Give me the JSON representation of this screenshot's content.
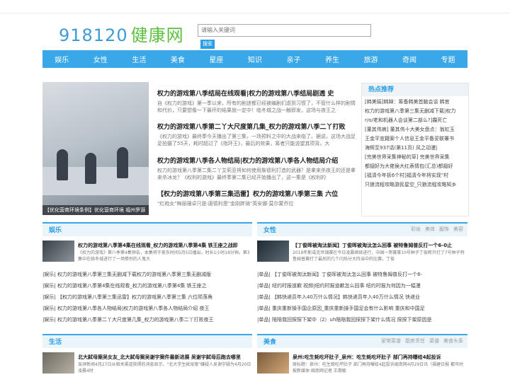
{
  "logo": {
    "number": "918120",
    "cn": "健康网"
  },
  "search": {
    "placeholder": "请输入关键词",
    "button": "搜索"
  },
  "nav": [
    "娱乐",
    "女性",
    "生活",
    "美食",
    "星座",
    "知识",
    "亲子",
    "养生",
    "旅游",
    "奇闻",
    "专题"
  ],
  "slideshow": {
    "caption": "【优化营商环境条例】优化营商环境 福州罗源"
  },
  "news": [
    {
      "title": "权力的游戏第八季结局在线观看|权力的游戏第八季结局剧透 史",
      "desc": "自《权力的游戏》第一季以来，所有的剧迷都已经被编剧们虐到习惯了，不管什么样的剧情和代价，只要想像一下最坏的结果就一定中！临冬城之战一触即发，这场与夜王之"
    },
    {
      "title": "权力的游戏第八季第二丫大尺度第几集_权力的游戏第八季二丫打败",
      "desc": "《权力的游戏》最终季今天播出了第三集，一场预料之中的大战来临了。据说，这场大战足足拍摄了55天，耗时超过了《指环王》，最后的效果，筹者只能说望其项背。大"
    },
    {
      "title": "权力的游戏第八季各人物结局|权力的游戏第八季各人物结局介绍",
      "desc": "权力的游戏第八季第二集二丫艾莉亚将如何使用詹德利打造的武器？是拿来杀夜王的还是拿来杀冰龙？《权利的游戏》最终季第二集已经开始播出了，这一集是《权利的"
    },
    {
      "title": "【权力的游戏第八季第三集迅雷】权力的游戏第八季第三集 六位",
      "desc": "\"红袍女\"梅丽珊卓只是:唐德利恩\"金刚胖骑\"英安娜·莫尔蒙乔拉"
    }
  ],
  "hot": {
    "title": "热点推荐",
    "items": [
      "[韩美娟]韩婵：筹备韩美首脑会谈 韩官",
      "权力的游戏第八季第三集无删减下载|权力",
      "r/o/老和机器人会谈第二部么?]霾死亡",
      "[董其伟病] 董其伟十大美女盘点：翁虹玉",
      "王金平宣籍案个人信息王金平备妥联署书",
      "海辉至937话(第11页) 风之动漫|",
      "[完美世界采集神秘的草] 完美世界采集",
      "都翅好为大佬侯大红表情包(汇总)都翅好",
      "[福清今年拆6个村]福清今年将实现\"村",
      "只狼流程攻略游民星空_只狼流程攻略知乡"
    ]
  },
  "sections": {
    "yule": {
      "title": "娱乐",
      "feature": {
        "title": "权力的游戏第八季第4集在线观看_权力的游戏第八季第4集 铁王座之战即",
        "desc": "《权力的游戏》第八季第4集预告，本集将于美东时间5月5日播出，时长1小时18分钟。第3集中在临冬城进行了一场惨烈的人鬼大"
      },
      "items": [
        "|娱乐| 权力的游戏第八季第三集无删减下载权力的游戏第八季第三集无删减版",
        "|娱乐| 权力的游戏第八季第4集在线观看_权力的游戏第八季第4集 铁王座之",
        "|娱乐| 【权力的游戏第八季第三集迅雷】权力的游戏第八季第三集 六位陨落角",
        "|娱乐| 权力的游戏第八季各人物结局|权力的游戏第八季各人物结局介绍 夜王",
        "|娱乐| 权力的游戏第八季第二丫大尺度第几集_权力的游戏第八季二丫打败夜王"
      ]
    },
    "nvxing": {
      "title": "女性",
      "tags": [
        "彩妆",
        "美体",
        "服饰",
        "美容"
      ],
      "feature": {
        "title": "【丁俊晖被淘汰新闻】丁俊晖被淘汰怎么回事 被特鲁姆普反打一个6-0止",
        "desc": "2019年斯诺克世锦赛在今日凌晨继续进行，中国一哥赛事10号种子丁俊晖只打了7号种子特鲁姆普赛打了最后的几个闪烁分大阵当中的比赛，丁俊"
      },
      "items": [
        "|单品| 【丁俊晖被淘汰新闻】丁俊晖被淘汰怎么回事 被特鲁姆普反打一个6-",
        "|单品| 纽约时报道歉 视频|纽约时报道歉怎么回事 纽约时报为何因为一幅漫",
        "|单品| 【韩快递员年入40万什么情况】韩快递员年入40万什么情况 快递业",
        "|单品| 重庆重新操手国企原因_重庆重新操手国足会有什么影响 重庆和中国足",
        "|单品| 陪陪我回探探下架中（2）uh陪陪我回探探下架什么情况 探探下架原因是"
      ]
    },
    "shenghuo": {
      "title": "生活",
      "feature": {
        "title": "北大弑母案吴女友_北大弑母案吴谢宇案件最新进展 吴谢宇弑母后跑去哪里",
        "desc": "澎湃新闻4月27日从相关渠道获得的消息显示，\"北大学生弑母案\"嫌疑人吴谢宇疑为4月20日凌晨4时"
      }
    },
    "meishi": {
      "title": "美食",
      "tags": [
        "家常菜谱",
        "厨房烹饪",
        "菜谱",
        "美食头条"
      ],
      "feature": {
        "title": "泉州:吃生蚝吃坏肚子_泉州：吃生蚝吃坏肚子 部门再持曝给4起投诉",
        "desc": "原标题：泉州：吃生蚝吃坏肚子 部门再持曝给4起投诉闽南网4月29日讯（福建日报 都市时报新媒体·闽南网记者 王惠敏"
      }
    }
  }
}
